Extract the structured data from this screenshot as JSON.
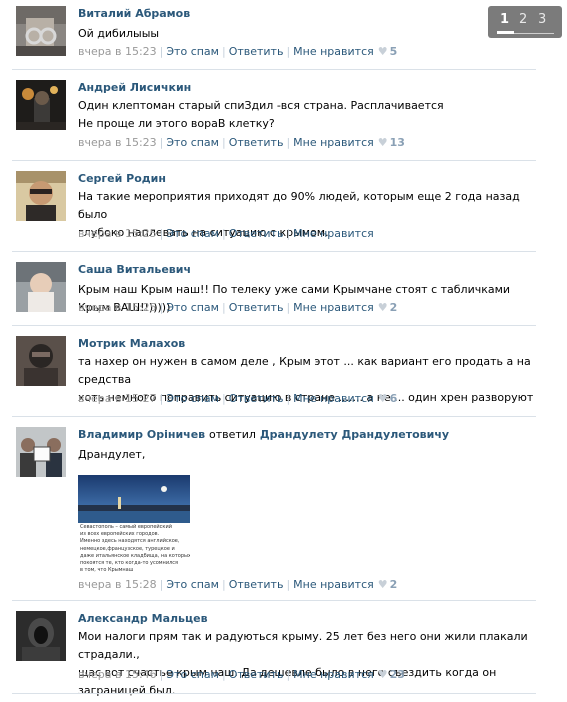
{
  "pager": {
    "pages": [
      "1",
      "2",
      "3"
    ],
    "active": "1"
  },
  "comments": [
    {
      "author": "Виталий Абрамов",
      "text": "Ой дибилыыы",
      "time": "вчера в 15:23",
      "spam": "Это спам",
      "reply": "Ответить",
      "like": "Мне нравится",
      "likes": "5",
      "avatar": "photo-handcuffs"
    },
    {
      "author": "Андрей Лисичкин",
      "text": "Один клептоман старый спиЗдил -вся страна. Расплачивается\nНе проще ли этого вораВ клетку?",
      "time": "вчера в 15:23",
      "spam": "Это спам",
      "reply": "Ответить",
      "like": "Мне нравится",
      "likes": "13",
      "avatar": "photo-night"
    },
    {
      "author": "Сергей Родин",
      "text": "На такие мероприятия приходят до 90% людей, которым еще 2 года назад было\nглубоко наплевать на ситуацию с крымом.",
      "time": "вчера в 15:25",
      "spam": "Это спам",
      "reply": "Ответить",
      "like": "Мне нравится",
      "likes": "",
      "avatar": "photo-man"
    },
    {
      "author": "Саша Витальевич",
      "text": "Крым наш Крым наш!! По телеку уже сами Крымчане стоят с табличками Крым ВАШ!!)))))",
      "time": "вчера в 15:25",
      "spam": "Это спам",
      "reply": "Ответить",
      "like": "Мне нравится",
      "likes": "2",
      "avatar": "photo-baby"
    },
    {
      "author": "Мотрик Малахов",
      "text": "та нахер он нужен в самом деле , Крым этот ... как вариант его продать а на средства\nхоть немного поправить ситуацию в стране ....... а не ... один хрен разворуют",
      "time": "вчера в 15:27",
      "spam": "Это спам",
      "reply": "Ответить",
      "like": "Мне нравится",
      "likes": "6",
      "avatar": "photo-masked"
    },
    {
      "author": "Владимир Оріничев",
      "reply_word": "ответил",
      "reply_to": "Драндулету Драндулетовичу",
      "text": "Драндулет,",
      "time": "вчера в 15:28",
      "spam": "Это спам",
      "reply": "Ответить",
      "like": "Мне нравится",
      "likes": "2",
      "avatar": "photo-group",
      "attachment": {
        "caption": "Севастополь – самый европейский\nиз всех европейских городов.\nИменно здесь находятся английское,\nнемецкое,французское, турецкое и\nдаже итальянское кладбища, на которых\nпокоятся те, кто когда-то усомнился\nв том, что Крымнаш"
      }
    },
    {
      "author": "Александр Мальцев",
      "text": "Мои налоги прям так и радуються крыму. 25 лет без него они жили плакали страдали.,\nщас вот счастье крым наш. Да дешевле было в него съездить когда он заграницей был.",
      "time": "вчера в 15:46",
      "spam": "Это спам",
      "reply": "Ответить",
      "like": "Мне нравится",
      "likes": "23",
      "avatar": "photo-hooded"
    }
  ]
}
